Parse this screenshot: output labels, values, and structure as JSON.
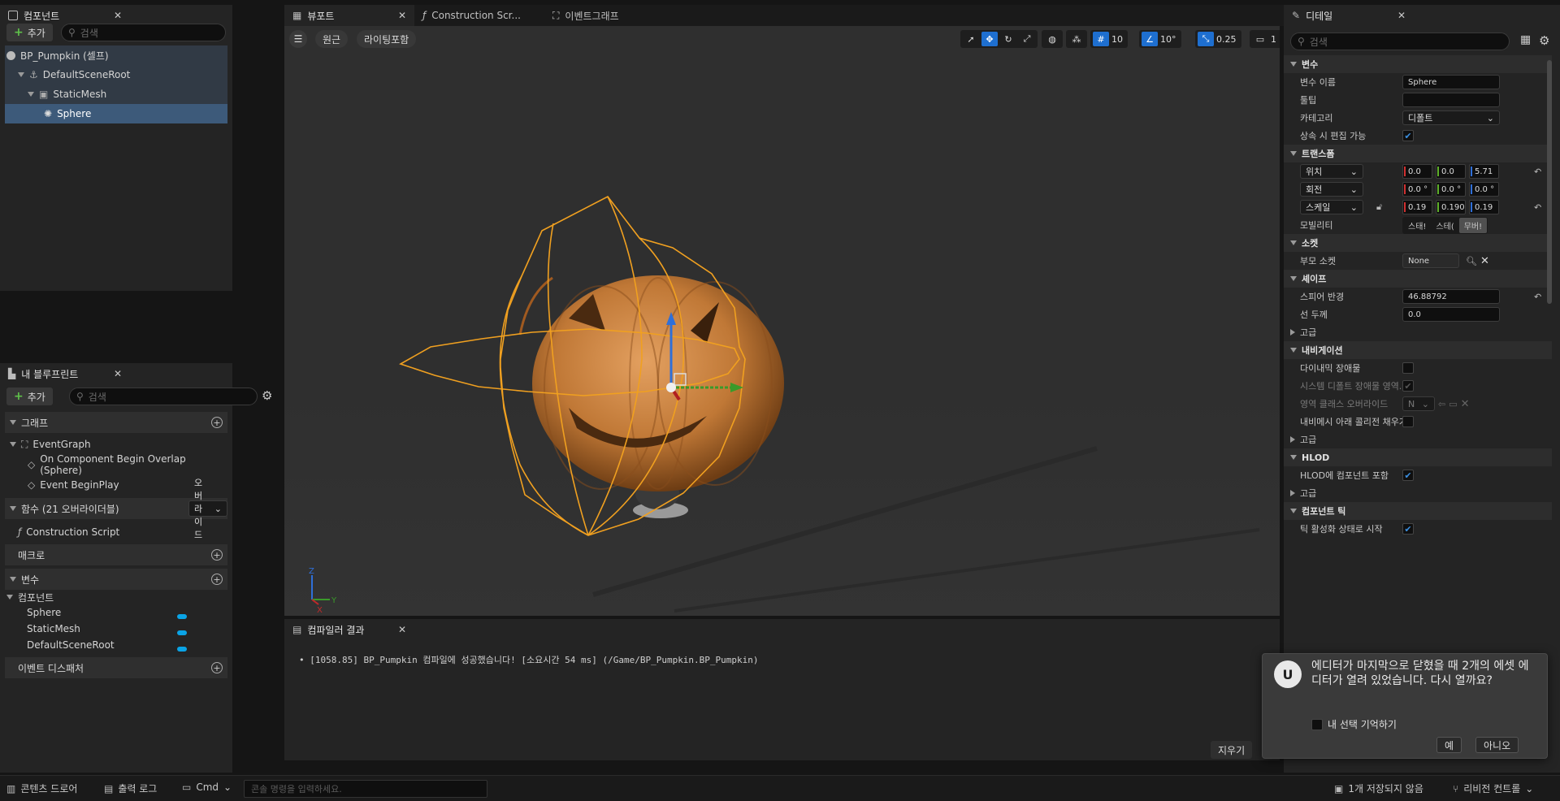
{
  "components_panel": {
    "tab_label": "컴포넌트",
    "add_label": "추가",
    "search_placeholder": "검색",
    "tree": [
      "BP_Pumpkin (셀프)",
      "DefaultSceneRoot",
      "StaticMesh",
      "Sphere"
    ]
  },
  "my_blueprint": {
    "tab_label": "내 블루프린트",
    "add_label": "추가",
    "search_placeholder": "검색",
    "graphs_label": "그래프",
    "event_graph": "EventGraph",
    "events": [
      "On Component Begin Overlap (Sphere)",
      "Event BeginPlay"
    ],
    "functions_label": "함수 (21 오버라이더블)",
    "override_label": "오버라이드",
    "construction_script": "Construction Script",
    "macros_label": "매크로",
    "variables_label": "변수",
    "components_label": "컴포넌트",
    "variables": [
      "Sphere",
      "StaticMesh",
      "DefaultSceneRoot"
    ],
    "dispatchers_label": "이벤트 디스패처"
  },
  "editor_tabs": [
    "뷰포트",
    "Construction Scr...",
    "이벤트그래프"
  ],
  "viewport": {
    "perspective_label": "원근",
    "lighting_label": "라이팅포함",
    "grid_snap": "10",
    "rotation_snap": "10°",
    "scale_snap": "0.25",
    "camera_speed": "1"
  },
  "compiler": {
    "tab_label": "컴파일러 결과",
    "message": "[1058.85] BP_Pumpkin 컴파일에 성공했습니다! [소요시간 54 ms] (/Game/BP_Pumpkin.BP_Pumpkin)",
    "clear_label": "지우기"
  },
  "details": {
    "tab_label": "디테일",
    "search_placeholder": "검색",
    "variable_section": "변수",
    "variable_name_label": "변수 이름",
    "variable_name_value": "Sphere",
    "tooltip_label": "툴팁",
    "category_label": "카테고리",
    "category_value": "디폴트",
    "editable_label": "상속 시 편집 가능",
    "transform_section": "트랜스폼",
    "location_label": "위치",
    "location": [
      "0.0",
      "0.0",
      "5.71"
    ],
    "rotation_label": "회전",
    "rotation": [
      "0.0 °",
      "0.0 °",
      "0.0 °"
    ],
    "scale_label": "스케일",
    "scale": [
      "0.19",
      "0.190",
      "0.19"
    ],
    "mobility_label": "모빌리티",
    "mobility_options": [
      "스태!",
      "스테(",
      "무버!"
    ],
    "socket_section": "소켓",
    "parent_socket_label": "부모 소켓",
    "parent_socket_value": "None",
    "shape_section": "셰이프",
    "sphere_radius_label": "스피어 반경",
    "sphere_radius_value": "46.88792",
    "line_thickness_label": "선 두께",
    "line_thickness_value": "0.0",
    "advanced_label": "고급",
    "navigation_section": "내비게이션",
    "dynamic_obstacle_label": "다이내믹 장애물",
    "system_default_label": "시스템 디폴트 장애물 영역...",
    "area_class_label": "영역 클래스 오버라이드",
    "area_class_value": "N",
    "fill_collision_label": "내비메시 아래 콜리전 채우기",
    "hlod_section": "HLOD",
    "hlod_include_label": "HLOD에 컴포넌트 포함",
    "component_tick_section": "컴포넌트 틱",
    "tick_start_label": "틱 활성화 상태로 시작"
  },
  "dialog": {
    "message": "에디터가 마지막으로 닫혔을 때 2개의 에셋 에디터가 열려 있었습니다. 다시 열까요?",
    "remember_label": "내 선택 기억하기",
    "yes_label": "예",
    "no_label": "아니오"
  },
  "status_bar": {
    "content_drawer": "콘텐츠 드로어",
    "output_log": "출력 로그",
    "cmd_label": "Cmd",
    "console_placeholder": "콘솔 명령을 입력하세요.",
    "unsaved": "1개 저장되지 않음",
    "revision_control": "리비전 컨트롤"
  },
  "colors": {
    "accent": "#1e6fd0",
    "selection": "#3d5a7a",
    "pumpkin": "#d08040",
    "bounds": "#f0a020",
    "variable": "#0aa4e6"
  }
}
